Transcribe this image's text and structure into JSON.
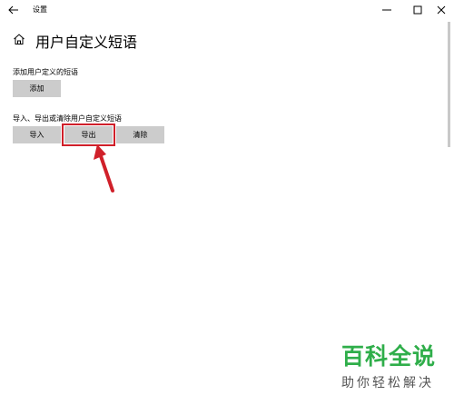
{
  "window": {
    "title": "设置",
    "controls": {
      "minimize": "minimize-icon",
      "maximize": "maximize-icon",
      "close": "close-icon"
    }
  },
  "header": {
    "home_icon": "home-icon",
    "title": "用户自定义短语"
  },
  "add_section": {
    "label": "添加用户定义的短语",
    "add_button": "添加"
  },
  "manage_section": {
    "label": "导入、导出或清除用户自定义短语",
    "import_button": "导入",
    "export_button": "导出",
    "clear_button": "清除"
  },
  "annotation": {
    "highlight_color": "#d0202a"
  },
  "watermark": {
    "main": "百科全说",
    "sub": "助你轻松解决"
  },
  "colors": {
    "button_bg": "#cccccc",
    "accent_red": "#d0202a",
    "watermark_green": "#2fae4a"
  }
}
